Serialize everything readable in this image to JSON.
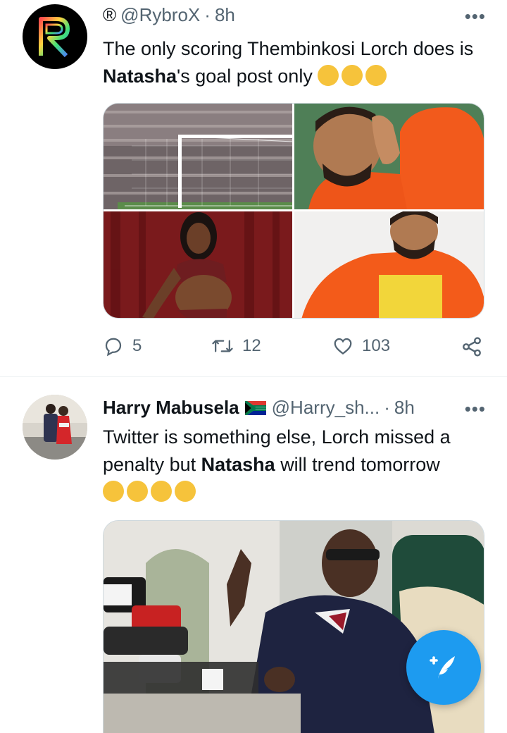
{
  "tweets": [
    {
      "avatar_letter": "R",
      "display_name": "®",
      "handle": "@RybroX",
      "separator": "·",
      "time": "8h",
      "more": "•••",
      "text_part1": "The only scoring Thembinkosi Lorch does is",
      "text_bold": "Natasha",
      "text_part2": "'s goal post only",
      "emojis": [
        "rofl-emoji",
        "rofl-emoji",
        "rofl-emoji"
      ],
      "counts": {
        "replies": "5",
        "retweets": "12",
        "likes": "103"
      }
    },
    {
      "display_name": "Harry Mabusela",
      "flag": "south-africa-flag",
      "handle": "@Harry_sh...",
      "separator": "·",
      "time": "8h",
      "more": "•••",
      "text_part1": "Twitter is something else, Lorch missed a",
      "text_part2": "penalty but",
      "text_bold": "Natasha",
      "text_part3": "will trend tomorrow",
      "emojis": [
        "sweat-smile-emoji",
        "sweat-smile-emoji",
        "sweat-smile-emoji",
        "sweat-smile-emoji"
      ]
    }
  ],
  "colors": {
    "accent": "#1d9bf0",
    "secondary_text": "#536471",
    "border": "#cfd9de"
  },
  "icons": [
    "reply-icon",
    "retweet-icon",
    "like-icon",
    "share-icon",
    "compose-icon"
  ]
}
